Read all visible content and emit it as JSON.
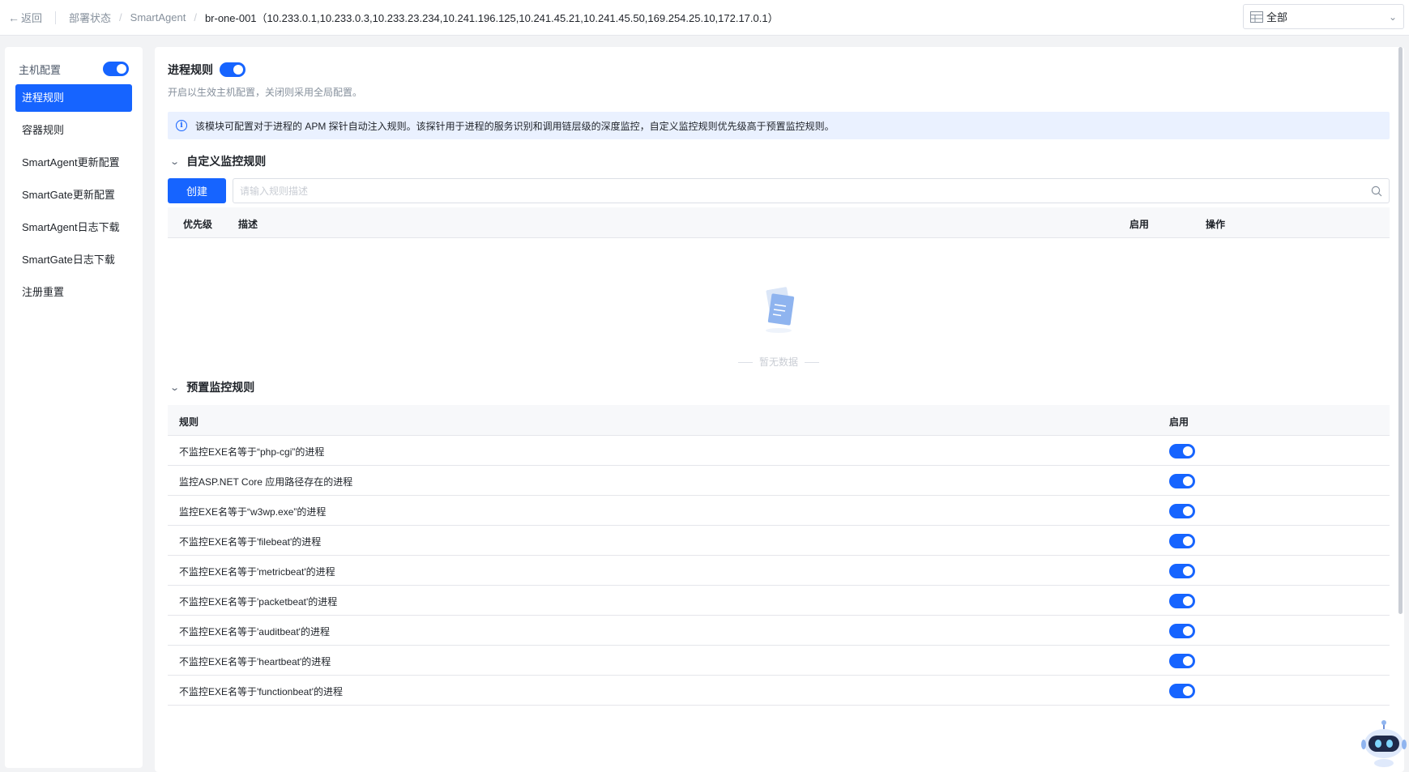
{
  "topbar": {
    "back_label": "返回",
    "breadcrumb": [
      "部署状态",
      "SmartAgent"
    ],
    "current": "br-one-001（10.233.0.1,10.233.0.3,10.233.23.234,10.241.196.125,10.241.45.21,10.241.45.50,169.254.25.10,172.17.0.1）",
    "scope_value": "全部"
  },
  "sidebar": {
    "host_config_label": "主机配置",
    "host_config_enabled": true,
    "items": [
      {
        "label": "进程规则",
        "active": true
      },
      {
        "label": "容器规则",
        "active": false
      },
      {
        "label": "SmartAgent更新配置",
        "active": false
      },
      {
        "label": "SmartGate更新配置",
        "active": false
      },
      {
        "label": "SmartAgent日志下载",
        "active": false
      },
      {
        "label": "SmartGate日志下载",
        "active": false
      },
      {
        "label": "注册重置",
        "active": false
      }
    ]
  },
  "main": {
    "title": "进程规则",
    "enabled": true,
    "description": "开启以生效主机配置，关闭则采用全局配置。",
    "info": "该模块可配置对于进程的 APM 探针自动注入规则。该探针用于进程的服务识别和调用链层级的深度监控，自定义监控规则优先级高于预置监控规则。",
    "custom": {
      "title": "自定义监控规则",
      "create_label": "创建",
      "search_placeholder": "请输入规则描述",
      "columns": {
        "priority": "优先级",
        "desc": "描述",
        "enabled": "启用",
        "ops": "操作"
      },
      "empty_text": "暂无数据"
    },
    "preset": {
      "title": "预置监控规则",
      "columns": {
        "rule": "规则",
        "enabled": "启用"
      },
      "rows": [
        {
          "rule": "不监控EXE名等于“php-cgi”的进程",
          "enabled": true
        },
        {
          "rule": "监控ASP.NET Core 应用路径存在的进程",
          "enabled": true
        },
        {
          "rule": "监控EXE名等于“w3wp.exe”的进程",
          "enabled": true
        },
        {
          "rule": "不监控EXE名等于'filebeat'的进程",
          "enabled": true
        },
        {
          "rule": "不监控EXE名等于'metricbeat'的进程",
          "enabled": true
        },
        {
          "rule": "不监控EXE名等于'packetbeat'的进程",
          "enabled": true
        },
        {
          "rule": "不监控EXE名等于'auditbeat'的进程",
          "enabled": true
        },
        {
          "rule": "不监控EXE名等于'heartbeat'的进程",
          "enabled": true
        },
        {
          "rule": "不监控EXE名等于'functionbeat'的进程",
          "enabled": true
        }
      ]
    }
  },
  "colors": {
    "primary": "#1664ff",
    "info_bg": "#eaf1ff",
    "table_header": "#f7f8fa"
  }
}
